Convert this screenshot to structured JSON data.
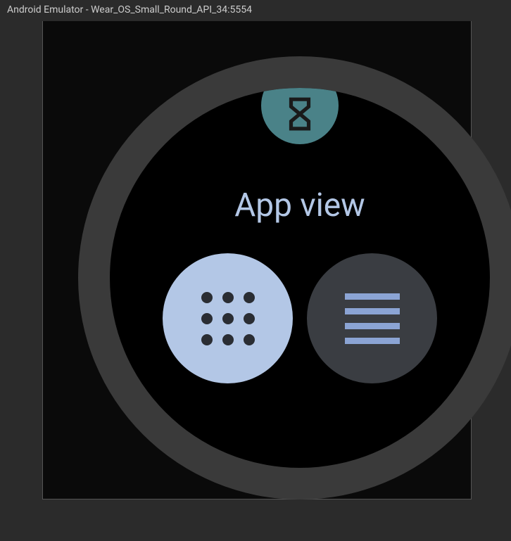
{
  "window": {
    "title": "Android Emulator - Wear_OS_Small_Round_API_34:5554"
  },
  "watch": {
    "title": "App view",
    "options": {
      "grid": {
        "selected": true
      },
      "list": {
        "selected": false
      }
    }
  }
}
